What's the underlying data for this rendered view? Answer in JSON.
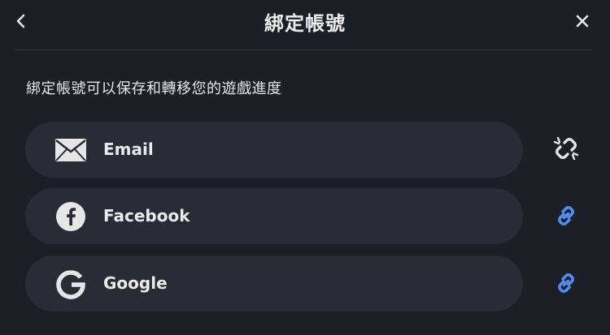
{
  "header": {
    "title": "綁定帳號",
    "back_icon": "chevron-left-icon",
    "close_icon": "close-icon"
  },
  "subtitle": "綁定帳號可以保存和轉移您的遊戲進度",
  "accounts": [
    {
      "label": "Email",
      "icon": "email-icon",
      "status": "unlinked",
      "status_icon": "unlink-icon"
    },
    {
      "label": "Facebook",
      "icon": "facebook-icon",
      "status": "linkable",
      "status_icon": "link-icon"
    },
    {
      "label": "Google",
      "icon": "google-icon",
      "status": "linkable",
      "status_icon": "link-icon"
    }
  ],
  "colors": {
    "background": "#1d1f26",
    "row_background": "#2a2c35",
    "text": "#e8e8ea",
    "link_accent": "#4d8ef0",
    "unlink_icon": "#e4e4e6"
  }
}
